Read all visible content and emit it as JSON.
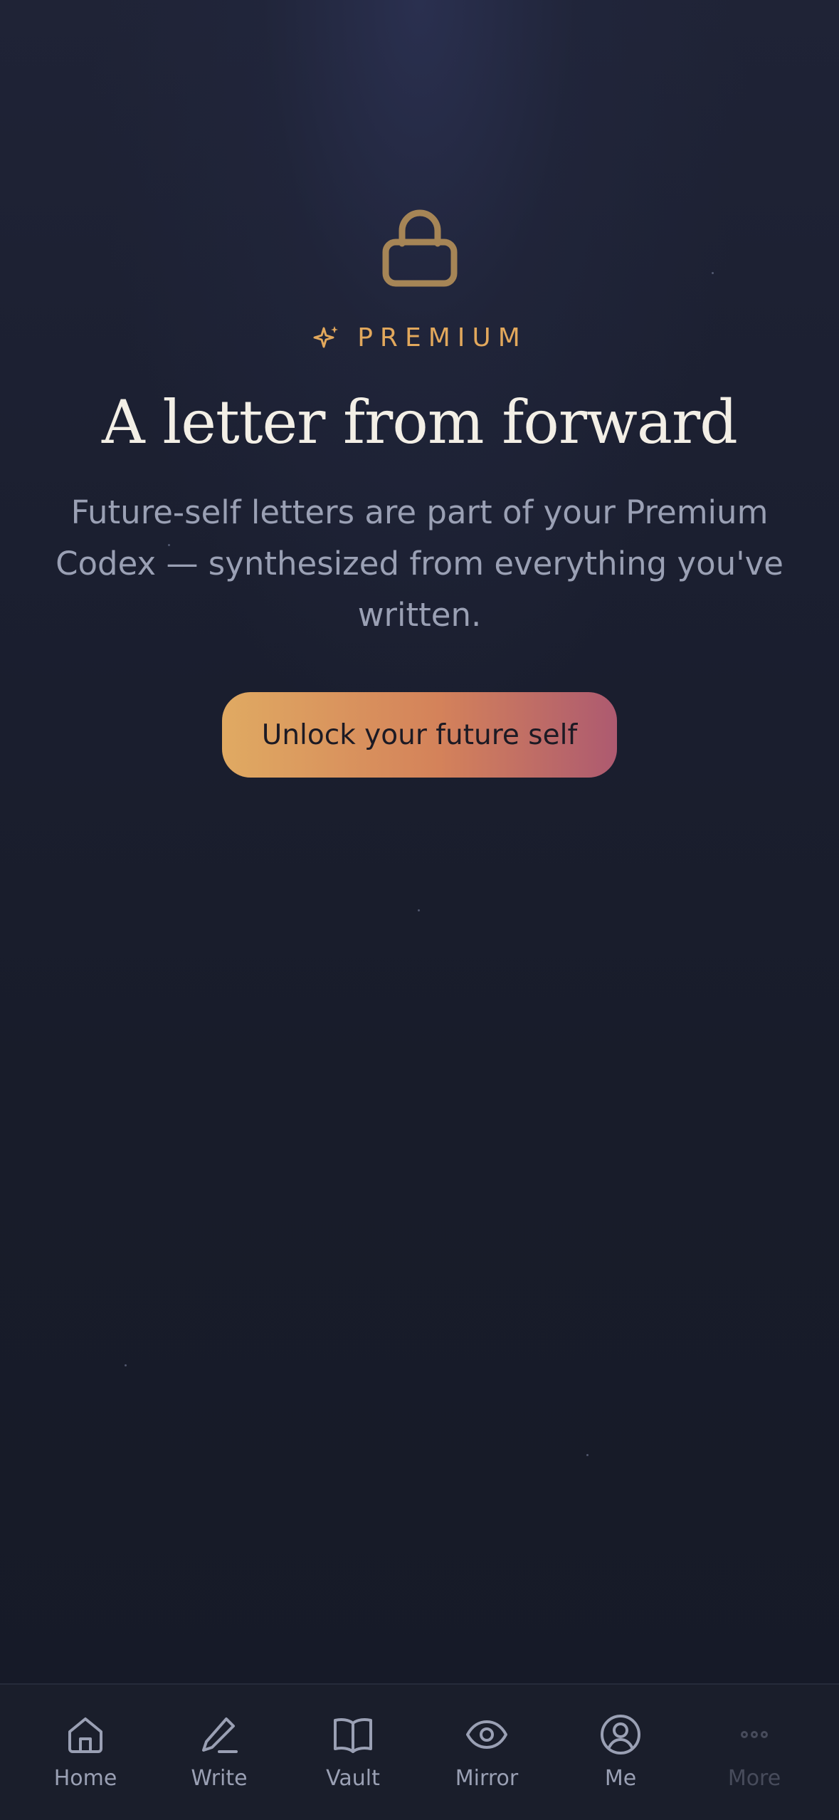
{
  "premium_tag": "PREMIUM",
  "title": "A letter from forward",
  "description": "Future-self letters are part of your Premium Codex — synthesized from everything you've written.",
  "cta_label": "Unlock your future self",
  "tabs": [
    {
      "label": "Home",
      "icon": "home-icon"
    },
    {
      "label": "Write",
      "icon": "pencil-icon"
    },
    {
      "label": "Vault",
      "icon": "book-icon"
    },
    {
      "label": "Mirror",
      "icon": "eye-icon"
    },
    {
      "label": "Me",
      "icon": "user-circle-icon"
    },
    {
      "label": "More",
      "icon": "more-dots-icon"
    }
  ],
  "colors": {
    "accent": "#e2a85c",
    "background": "#171b29",
    "cta_gradient_start": "#e0aa62",
    "cta_gradient_end": "#ad5a70",
    "muted_text": "#9aa0b4"
  }
}
